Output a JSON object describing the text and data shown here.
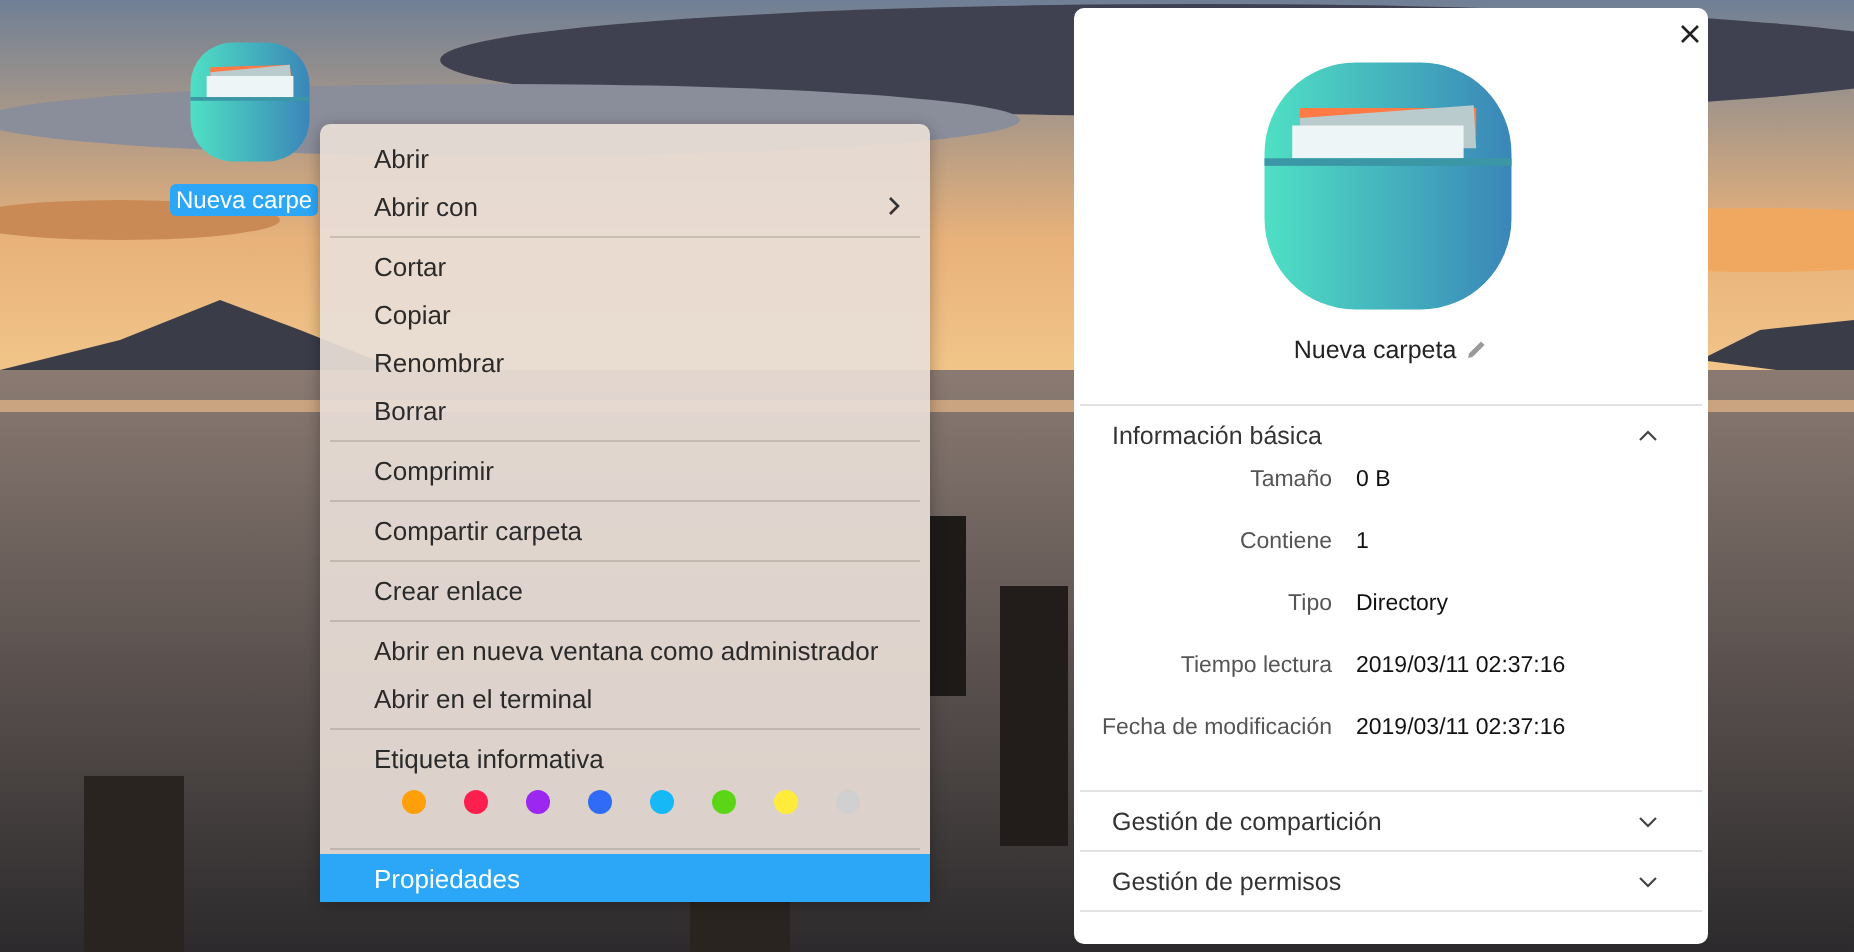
{
  "desktop": {
    "icons": [
      {
        "label": "Nueva carpe",
        "selected": true
      }
    ]
  },
  "context_menu": {
    "groups": [
      {
        "items": [
          {
            "label": "Abrir",
            "kind": "item",
            "selected": false
          },
          {
            "label": "Abrir con",
            "kind": "submenu",
            "selected": false
          }
        ]
      },
      {
        "items": [
          {
            "label": "Cortar",
            "kind": "item",
            "selected": false
          },
          {
            "label": "Copiar",
            "kind": "item",
            "selected": false
          },
          {
            "label": "Renombrar",
            "kind": "item",
            "selected": false
          },
          {
            "label": "Borrar",
            "kind": "item",
            "selected": false
          }
        ]
      },
      {
        "items": [
          {
            "label": "Comprimir",
            "kind": "item",
            "selected": false
          }
        ]
      },
      {
        "items": [
          {
            "label": "Compartir carpeta",
            "kind": "item",
            "selected": false
          }
        ]
      },
      {
        "items": [
          {
            "label": "Crear enlace",
            "kind": "item",
            "selected": false
          }
        ]
      },
      {
        "items": [
          {
            "label": "Abrir en nueva ventana como administrador",
            "kind": "item",
            "selected": false
          },
          {
            "label": "Abrir en el terminal",
            "kind": "item",
            "selected": false
          }
        ]
      },
      {
        "items": [
          {
            "label": "Etiqueta informativa",
            "kind": "tags",
            "selected": false,
            "tags": [
              {
                "color": "#ff9f0a"
              },
              {
                "color": "#ff1f4f"
              },
              {
                "color": "#9c27f0"
              },
              {
                "color": "#2f6bf5"
              },
              {
                "color": "#16b8f5"
              },
              {
                "color": "#5bd616"
              },
              {
                "color": "#ffeb3b"
              },
              {
                "color": "#d0d0d0"
              }
            ]
          }
        ]
      },
      {
        "items": [
          {
            "label": "Propiedades",
            "kind": "item",
            "selected": true
          }
        ]
      }
    ]
  },
  "properties": {
    "name": "Nueva carpeta",
    "sections": [
      {
        "title": "Información básica",
        "expanded": true,
        "rows": [
          {
            "label": "Tamaño",
            "value": "0 B"
          },
          {
            "label": "Contiene",
            "value": "1"
          },
          {
            "label": "Tipo",
            "value": "Directory"
          },
          {
            "label": "Tiempo lectura",
            "value": "2019/03/11 02:37:16"
          },
          {
            "label": "Fecha de modificación",
            "value": "2019/03/11 02:37:16"
          }
        ]
      },
      {
        "title": "Gestión de compartición",
        "expanded": false
      },
      {
        "title": "Gestión de permisos",
        "expanded": false
      }
    ]
  }
}
